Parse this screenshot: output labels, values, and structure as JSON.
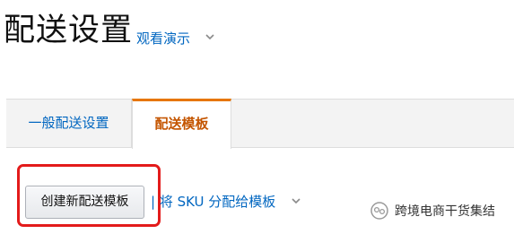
{
  "header": {
    "title": "配送设置",
    "demo_link": "观看演示"
  },
  "tabs": [
    {
      "label": "一般配送设置",
      "active": false
    },
    {
      "label": "配送模板",
      "active": true
    }
  ],
  "actions": {
    "create_button": "创建新配送模板",
    "assign_link": "| 将 SKU 分配给模板"
  },
  "watermark": {
    "text": "跨境电商干货集结",
    "icon": "wechat-official-account-icon"
  },
  "colors": {
    "link": "#0066c0",
    "active_tab_text": "#c45500",
    "active_tab_border": "#e77600",
    "highlight_box": "#e31b1b"
  },
  "icons": {
    "demo_dropdown": "chevron-down-icon",
    "assign_dropdown": "chevron-down-icon"
  }
}
